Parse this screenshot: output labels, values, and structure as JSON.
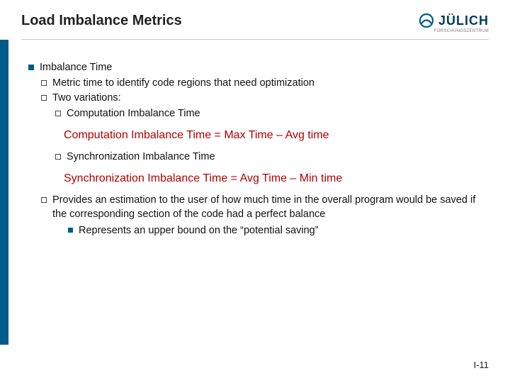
{
  "header": {
    "title": "Load Imbalance Metrics",
    "logo_text": "JÜLICH",
    "logo_sub": "FORSCHUNGSZENTRUM"
  },
  "content": {
    "l1": "Imbalance Time",
    "l2": "Metric time to identify code regions that need optimization",
    "l3": "Two variations:",
    "l4": "Computation Imbalance Time",
    "formula1": "Computation Imbalance Time = Max Time – Avg time",
    "l5": "Synchronization Imbalance Time",
    "formula2": "Synchronization Imbalance Time = Avg Time – Min time",
    "l6": "Provides an estimation to the user of how much time in the overall program would be saved if the corresponding section of the code had a perfect balance",
    "l7": "Represents an upper bound on the “potential saving”"
  },
  "page": "I-11"
}
